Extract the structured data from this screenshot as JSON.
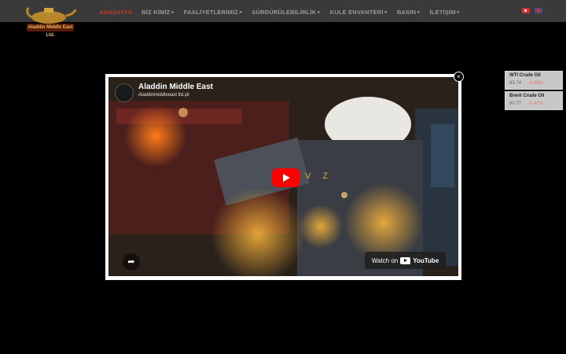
{
  "header": {
    "logo_text": "Aladdin Middle East Ltd.",
    "nav": [
      {
        "label": "ANASAYFA",
        "active": true,
        "has_caret": false
      },
      {
        "label": "BİZ KİMİZ",
        "active": false,
        "has_caret": true
      },
      {
        "label": "FAALİYETLERİMİZ",
        "active": false,
        "has_caret": true
      },
      {
        "label": "SÜRDÜRÜLEBİLİRLİK",
        "active": false,
        "has_caret": true
      },
      {
        "label": "KULE ENVANTERİ",
        "active": false,
        "has_caret": true
      },
      {
        "label": "BASIN",
        "active": false,
        "has_caret": true
      },
      {
        "label": "İLETİŞİM",
        "active": false,
        "has_caret": true
      }
    ],
    "flags": [
      "turkish-flag-icon",
      "english-flag-icon"
    ]
  },
  "ticker": [
    {
      "name": "WTI Crude Oil",
      "price": "83.74",
      "change": "-0.45%"
    },
    {
      "name": "Brent Crude Oil",
      "price": "90.77",
      "change": "-0.42%"
    }
  ],
  "video": {
    "title": "Aladdin Middle East",
    "channel": "Aladdinmiddleeast ltd.şti",
    "overlay_text": "V Z",
    "watch_on": "Watch on",
    "brand": "YouTube"
  },
  "colors": {
    "active_nav": "#c0392b",
    "youtube_red": "#ff0000",
    "change_negative": "#e57373"
  }
}
